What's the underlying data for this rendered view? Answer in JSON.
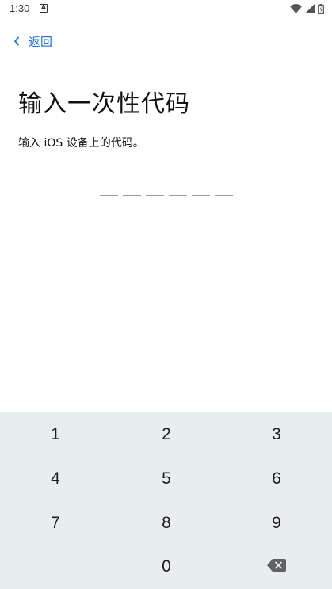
{
  "status_bar": {
    "time": "1:30",
    "notification_icon": "a-icon",
    "right_icons": [
      "wifi-icon",
      "signal-icon",
      "battery-icon"
    ]
  },
  "nav": {
    "back_icon": "chevron-left-icon",
    "back_label": "返回",
    "accent_color": "#1a73e8"
  },
  "content": {
    "title": "输入一次性代码",
    "subtitle": "输入 iOS 设备上的代码。",
    "code_length": 6
  },
  "keypad": {
    "background": "#e8edf0",
    "keys": [
      "1",
      "2",
      "3",
      "4",
      "5",
      "6",
      "7",
      "8",
      "9",
      "0"
    ],
    "delete_icon": "backspace-icon"
  }
}
